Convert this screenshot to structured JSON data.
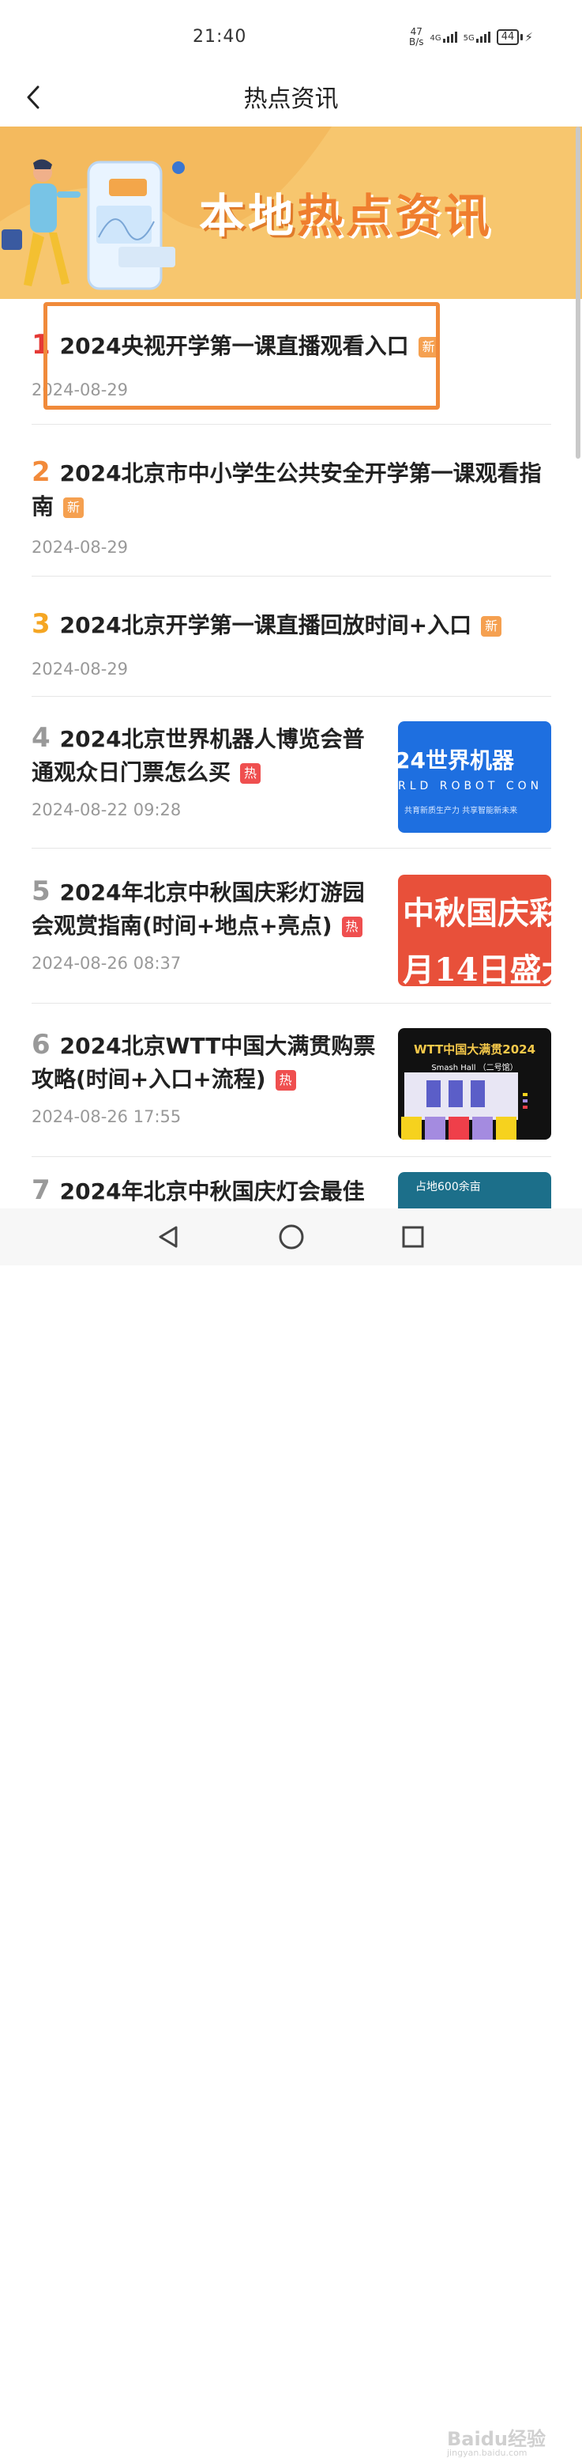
{
  "status_bar": {
    "time": "21:40",
    "net_speed_value": "47",
    "net_speed_unit": "B/s",
    "signal_1": "4G",
    "signal_2": "5G",
    "battery": "44"
  },
  "header": {
    "title": "热点资讯",
    "back_icon": "chevron-left-icon"
  },
  "banner": {
    "text_part1": "本地",
    "text_part2": "热点资讯"
  },
  "news": [
    {
      "rank": "1",
      "title": "2024央视开学第一课直播观看入口",
      "badge": "新",
      "date": "2024-08-29",
      "rank_color": "#e53935"
    },
    {
      "rank": "2",
      "title": "2024北京市中小学生公共安全开学第一课观看指南",
      "badge": "新",
      "date": "2024-08-29",
      "rank_color": "#f28a3a"
    },
    {
      "rank": "3",
      "title": "2024北京开学第一课直播回放时间+入口",
      "badge": "新",
      "date": "2024-08-29",
      "rank_color": "#f5a623"
    },
    {
      "rank": "4",
      "title": "2024北京世界机器人博览会普通观众日门票怎么买",
      "badge": "热",
      "date": "2024-08-22 09:28",
      "rank_color": "#999999",
      "thumb": {
        "line1": "24世界机器",
        "line2": "RLD ROBOT CON",
        "line3": "共育新质生产力 共享智能新未来",
        "bg": "#1e6fe0"
      }
    },
    {
      "rank": "5",
      "title": "2024年北京中秋国庆彩灯游园会观赏指南(时间+地点+亮点)",
      "badge": "热",
      "date": "2024-08-26 08:37",
      "rank_color": "#999999",
      "thumb": {
        "line1": "中秋国庆彩",
        "line2": "月14日盛大",
        "bg": "#e8503a"
      }
    },
    {
      "rank": "6",
      "title": "2024北京WTT中国大满贯购票攻略(时间+入口+流程)",
      "badge": "热",
      "date": "2024-08-26 17:55",
      "rank_color": "#999999",
      "thumb": {
        "line1": "WTT中国大满贯2024",
        "line2": "Smash Hall （二号馆）",
        "bg": "#111111"
      }
    },
    {
      "rank": "7",
      "title": "2024年北京中秋国庆灯会最佳",
      "thumb_text": "占地600余亩"
    }
  ],
  "navigation": {
    "back": "triangle-back-icon",
    "home": "circle-home-icon",
    "recent": "square-recent-icon"
  },
  "watermark": {
    "main": "Baidu经验",
    "sub": "jingyan.baidu.com"
  }
}
